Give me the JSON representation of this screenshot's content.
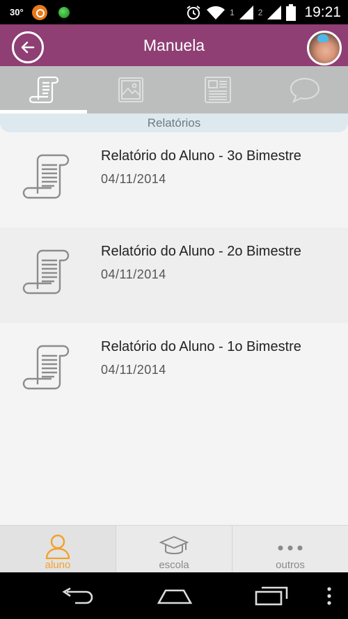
{
  "status_bar": {
    "temperature": "30°",
    "sim1": "1",
    "sim2": "2",
    "time": "19:21"
  },
  "header": {
    "title": "Manuela"
  },
  "tabs": [
    {
      "name": "relatorios",
      "icon": "scroll-icon",
      "active": true
    },
    {
      "name": "fotos",
      "icon": "image-icon",
      "active": false
    },
    {
      "name": "noticias",
      "icon": "newspaper-icon",
      "active": false
    },
    {
      "name": "mensagens",
      "icon": "speech-bubble-icon",
      "active": false
    }
  ],
  "section": {
    "label": "Relatórios"
  },
  "reports": [
    {
      "title": "Relatório do Aluno - 3o Bimestre",
      "date": "04/11/2014"
    },
    {
      "title": "Relatório do Aluno - 2o Bimestre",
      "date": "04/11/2014"
    },
    {
      "title": "Relatório do Aluno - 1o Bimestre",
      "date": "04/11/2014"
    }
  ],
  "bottom_nav": [
    {
      "label": "aluno",
      "icon": "person-icon",
      "active": true
    },
    {
      "label": "escola",
      "icon": "graduation-cap-icon",
      "active": false
    },
    {
      "label": "outros",
      "icon": "more-dots-icon",
      "active": false
    }
  ],
  "colors": {
    "header": "#8f3f74",
    "tab_bar": "#bcbebe",
    "section_bg": "#dde9ef",
    "active_accent": "#f3a12a"
  }
}
